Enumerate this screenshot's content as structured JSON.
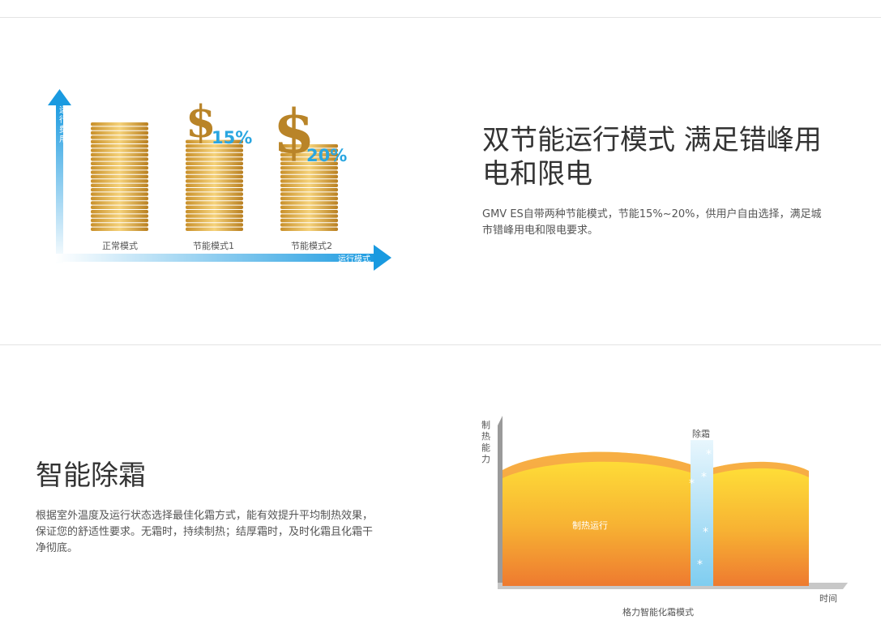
{
  "section1": {
    "title_line1": "双节能运行模式 满足错峰用",
    "title_line2": "电和限电",
    "desc_line1": "GMV ES自带两种节能模式，节能15%~20%，供用户自由选择，满足城",
    "desc_line2": "市错峰用电和限电要求。",
    "chart": {
      "y_axis_label": [
        "运",
        "行",
        "费",
        "用"
      ],
      "x_axis_label": "运行模式",
      "bars": [
        {
          "label": "正常模式",
          "level": 1.0,
          "saving": ""
        },
        {
          "label": "节能模式1",
          "level": 0.85,
          "saving": "15%"
        },
        {
          "label": "节能模式2",
          "level": 0.8,
          "saving": "20%"
        }
      ],
      "dollar_symbol": "$",
      "colors": {
        "axis": "#1a9ae0",
        "coin": "#e0b04a",
        "percent": "#2aa6e0"
      }
    }
  },
  "section2": {
    "title": "智能除霜",
    "desc_line1": "根据室外温度及运行状态选择最佳化霜方式，能有效提升平均制热效果，",
    "desc_line2": "保证您的舒适性要求。无霜时，持续制热；结厚霜时，及时化霜且化霜干",
    "desc_line3": "净彻底。",
    "chart": {
      "y_axis_label": [
        "制",
        "热",
        "能",
        "力"
      ],
      "x_axis_label": "时间",
      "defrost_label": "除霜",
      "heating_label": "制热运行",
      "caption": "格力智能化霜模式",
      "snow_symbol": "*",
      "colors": {
        "heat_top": "#ffd830",
        "heat_bottom": "#f08a30",
        "defrost": "#aee0f5"
      }
    }
  }
}
